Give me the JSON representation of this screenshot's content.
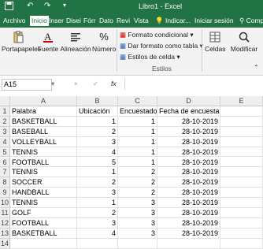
{
  "title_bar": {
    "title": "Libro1 - Excel",
    "quick_access": [
      "save-icon",
      "undo-icon",
      "redo-icon",
      "customize-icon"
    ]
  },
  "tabs": [
    {
      "label": "Archivo",
      "active": false
    },
    {
      "label": "Inicio",
      "active": true
    },
    {
      "label": "Inser",
      "active": false
    },
    {
      "label": "Disei",
      "active": false
    },
    {
      "label": "Fórr",
      "active": false
    },
    {
      "label": "Dato",
      "active": false
    },
    {
      "label": "Revi",
      "active": false
    },
    {
      "label": "Vista",
      "active": false
    },
    {
      "label": "Indicar...",
      "active": false
    },
    {
      "label": "Iniciar sesión",
      "active": false
    },
    {
      "label": "Comp",
      "active": false
    }
  ],
  "ribbon": {
    "clipboard": "Portapapeles",
    "font": "Fuente",
    "alignment": "Alineación",
    "number": "Número",
    "cond_format": "Formato condicional",
    "table_format": "Dar formato como tabla",
    "cell_styles": "Estilos de celda",
    "styles_group": "Estilos",
    "cells": "Celdas",
    "modify": "Modificar"
  },
  "formula_bar": {
    "name_box": "A15",
    "cancel": "×",
    "confirm": "✓",
    "fx": "fx",
    "content": ""
  },
  "grid": {
    "columns": [
      "A",
      "B",
      "C",
      "D",
      "E"
    ],
    "header": [
      "Palabra",
      "Ubicación",
      "Encuestado",
      "Fecha de encuesta"
    ],
    "rows": [
      [
        "BASKETBALL",
        "1",
        "1",
        "28-10-2019"
      ],
      [
        "BASEBALL",
        "2",
        "1",
        "28-10-2019"
      ],
      [
        "VOLLEYBALL",
        "3",
        "1",
        "28-10-2019"
      ],
      [
        "TENNIS",
        "4",
        "1",
        "28-10-2019"
      ],
      [
        "FOOTBALL",
        "5",
        "1",
        "28-10-2019"
      ],
      [
        "TENNIS",
        "1",
        "2",
        "28-10-2019"
      ],
      [
        "SOCCER",
        "2",
        "2",
        "28-10-2019"
      ],
      [
        "HANDBALL",
        "3",
        "2",
        "28-10-2019"
      ],
      [
        "TENNIS",
        "1",
        "3",
        "28-10-2019"
      ],
      [
        "GOLF",
        "2",
        "3",
        "28-10-2019"
      ],
      [
        "FOOTBALL",
        "3",
        "3",
        "28-10-2019"
      ],
      [
        "BASKETBALL",
        "4",
        "3",
        "28-10-2019"
      ]
    ]
  }
}
